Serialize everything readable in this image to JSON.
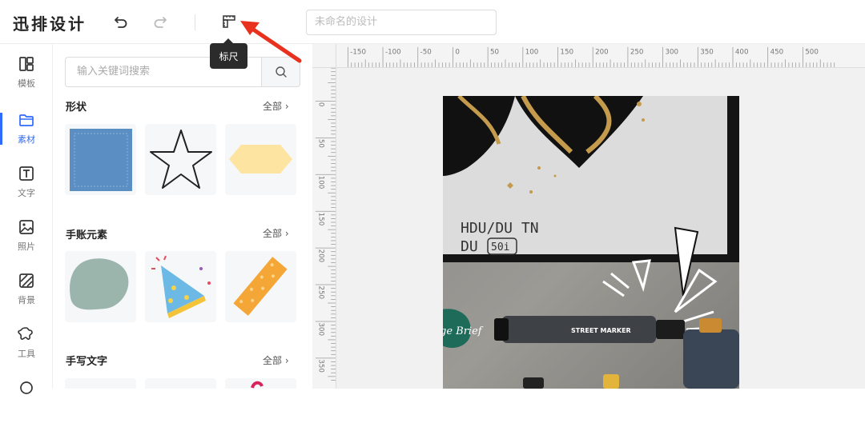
{
  "app": {
    "logo": "迅排设计",
    "title_placeholder": "未命名的设计",
    "tooltip": "标尺"
  },
  "nav": {
    "items": [
      {
        "label": "模板",
        "icon": "template-icon"
      },
      {
        "label": "素材",
        "icon": "folder-icon",
        "active": true
      },
      {
        "label": "文字",
        "icon": "text-icon"
      },
      {
        "label": "照片",
        "icon": "photo-icon"
      },
      {
        "label": "背景",
        "icon": "background-icon"
      },
      {
        "label": "工具",
        "icon": "tools-icon"
      }
    ]
  },
  "panel": {
    "search_placeholder": "输入关键词搜索",
    "sections": [
      {
        "title": "形状",
        "all": "全部 ›"
      },
      {
        "title": "手账元素",
        "all": "全部 ›"
      },
      {
        "title": "手写文字",
        "all": "全部 ›"
      }
    ]
  },
  "ruler": {
    "top_labels": [
      "-150",
      "-100",
      "-50",
      "0",
      "50",
      "100",
      "150",
      "200",
      "250",
      "300",
      "350",
      "400",
      "450",
      "500"
    ],
    "left_labels": [
      "0",
      "50",
      "100",
      "150",
      "200",
      "250",
      "300",
      "350"
    ]
  },
  "artwork": {
    "line1": "HDU/DU TN",
    "line2a": "DU",
    "line2b": "50i",
    "sticker": "ge Brief",
    "marker_label": "STREET MARKER"
  },
  "colors": {
    "accent": "#2f6bff",
    "arrow": "#e8321f",
    "tooltip_bg": "#2b2b2b"
  }
}
